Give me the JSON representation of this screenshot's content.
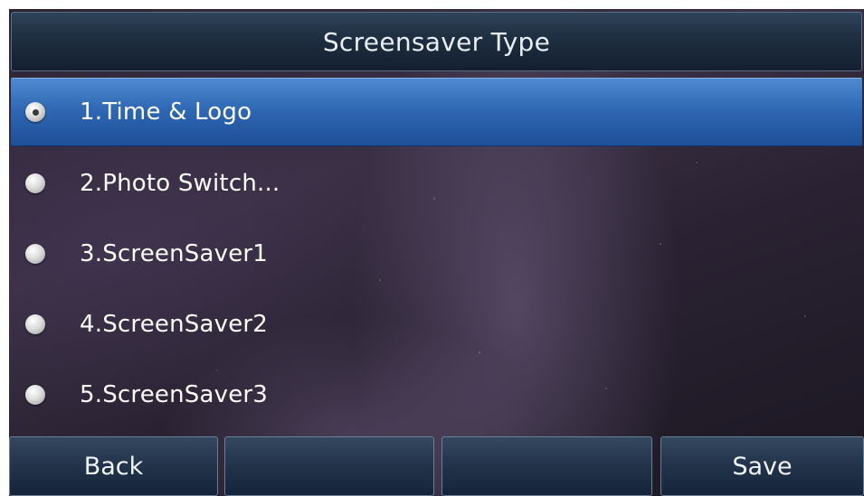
{
  "title": "Screensaver Type",
  "options": [
    {
      "label": "1.Time & Logo",
      "selected": true
    },
    {
      "label": "2.Photo Switch...",
      "selected": false
    },
    {
      "label": "3.ScreenSaver1",
      "selected": false
    },
    {
      "label": "4.ScreenSaver2",
      "selected": false
    },
    {
      "label": "5.ScreenSaver3",
      "selected": false
    }
  ],
  "softkeys": [
    "Back",
    "",
    "",
    "Save"
  ],
  "colors": {
    "highlight": "#2f68b4",
    "title_bar": "#1d2c3e",
    "text": "#ffffff"
  }
}
